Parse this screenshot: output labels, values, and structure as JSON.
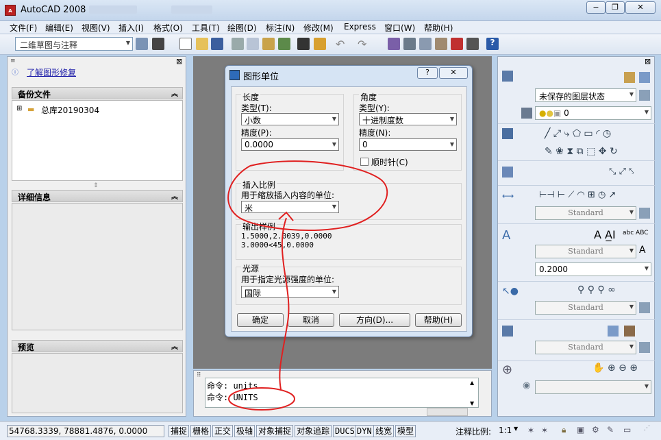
{
  "window": {
    "title": "AutoCAD 2008",
    "controls": {
      "minimize": "−",
      "restore": "❐",
      "close": "✕"
    }
  },
  "menu": [
    "文件(F)",
    "编辑(E)",
    "视图(V)",
    "插入(I)",
    "格式(O)",
    "工具(T)",
    "绘图(D)",
    "标注(N)",
    "修改(M)",
    "Express",
    "窗口(W)",
    "帮助(H)"
  ],
  "workspace": {
    "value": "二维草图与注释"
  },
  "left_panel": {
    "link": "了解图形修复",
    "backup_title": "备份文件",
    "backup_item": "总库20190304",
    "details_title": "详细信息",
    "preview_title": "预览"
  },
  "dialog": {
    "title": "图形单位",
    "help_btn": "?",
    "length": {
      "group": "长度",
      "type_label": "类型(T):",
      "type_value": "小数",
      "precision_label": "精度(P):",
      "precision_value": "0.0000"
    },
    "angle": {
      "group": "角度",
      "type_label": "类型(Y):",
      "type_value": "十进制度数",
      "precision_label": "精度(N):",
      "precision_value": "0",
      "clockwise": "顺时针(C)"
    },
    "insert": {
      "group": "插入比例",
      "label": "用于缩放插入内容的单位:",
      "value": "米"
    },
    "output": {
      "group": "输出样例",
      "line1": "1.5000,2.0039,0.0000",
      "line2": "3.0000<45,0.0000"
    },
    "light": {
      "group": "光源",
      "label": "用于指定光源强度的单位:",
      "value": "国际"
    },
    "buttons": {
      "ok": "确定",
      "cancel": "取消",
      "direction": "方向(D)...",
      "help": "帮助(H)"
    }
  },
  "command": {
    "line1": "命令: units",
    "line2": "命令: UNITS"
  },
  "right_panel": {
    "layer_state": "未保存的图层状态",
    "layer_name": "0",
    "dim_style": "Standard",
    "text_style": "Standard",
    "text_height": "0.2000",
    "mleader_style": "Standard",
    "table_style": "Standard"
  },
  "status": {
    "coords": "54768.3339, 78881.4876, 0.0000",
    "toggles": [
      "捕捉",
      "栅格",
      "正交",
      "极轴",
      "对象捕捉",
      "对象追踪",
      "DUCS",
      "DYN",
      "线宽",
      "模型"
    ],
    "anno_scale_label": "注释比例:",
    "anno_scale_value": "1:1"
  },
  "colors": {
    "annotation": "#e02020",
    "title_bar": "#c4d6ec",
    "canvas": "#7c7c7c"
  }
}
